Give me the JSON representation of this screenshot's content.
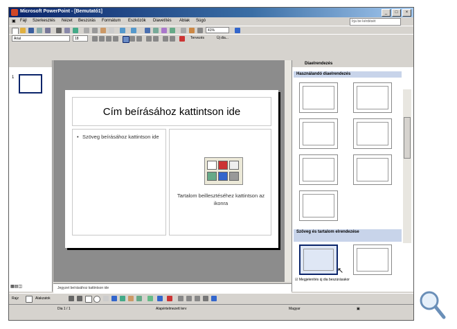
{
  "window": {
    "title": "Microsoft PowerPoint - [Bemutató1]",
    "controls": [
      "_",
      "□",
      "×"
    ]
  },
  "menubar": {
    "items": [
      "Fájl",
      "Szerkesztés",
      "Nézet",
      "Beszúrás",
      "Formátum",
      "Eszközök",
      "Diavetítés",
      "Ablak",
      "Súgó"
    ],
    "help_placeholder": "Írja be kérdését"
  },
  "formatting": {
    "font": "Arial",
    "size": "18",
    "zoom": "41%",
    "design_label": "Tervezés",
    "new_slide_label": "Új dia..."
  },
  "outline": {
    "slide_number": "1"
  },
  "slide": {
    "title": "Cím beírásához kattintson ide",
    "bullet_text": "Szöveg beírásához kattintson ide",
    "content_text": "Tartalom beillesztéséhez kattintson az ikonra"
  },
  "notes": {
    "placeholder": "Jegyzet beírásához kattintson ide"
  },
  "taskpane": {
    "title": "Diaelrendezés",
    "section_content": "Használandó diaelrendezés",
    "section_text_content": "Szöveg és tartalom elrendezése",
    "check_label": "Megjelenítés új dia beszúrásakor"
  },
  "drawing": {
    "draw_label": "Rajz",
    "autoshapes_label": "Alakzatok"
  },
  "status": {
    "slide": "Dia 1 / 1",
    "design": "Alapértelmezett terv",
    "language": "Magyar"
  }
}
